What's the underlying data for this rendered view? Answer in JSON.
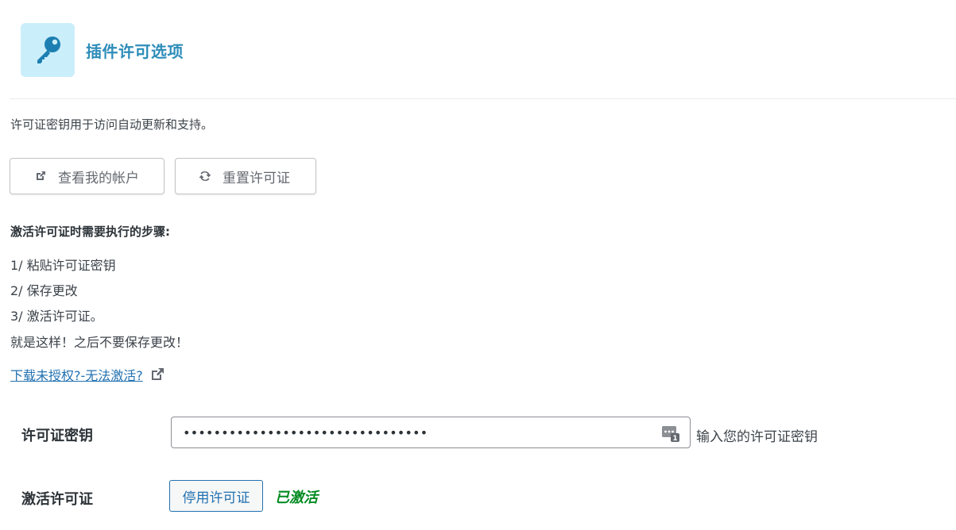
{
  "header": {
    "title": "插件许可选项",
    "icon": "key-icon",
    "icon_bg": "#cbeefb",
    "title_color": "#2e8db9"
  },
  "intro": "许可证密钥用于访问自动更新和支持。",
  "buttons": {
    "account_label": "查看我的帐户",
    "account_icon": "external-link-icon",
    "reset_label": "重置许可证",
    "reset_icon": "refresh-icon"
  },
  "steps": {
    "heading": "激活许可证时需要执行的步骤:",
    "items": [
      "1/ 粘贴许可证密钥",
      "2/ 保存更改",
      "3/ 激活许可证。",
      "就是这样！之后不要保存更改！"
    ]
  },
  "help_link": {
    "text": "下载未授权?-无法激活?",
    "icon": "external-link-icon"
  },
  "license_key": {
    "label": "许可证密钥",
    "value": "••••••••••••••••••••••••••••••••",
    "hint": "输入您的许可证密钥",
    "tool_icon": "password-manager-icon"
  },
  "activation": {
    "label": "激活许可证",
    "button_label": "停用许可证",
    "status": "已激活",
    "status_color": "#008a20"
  }
}
